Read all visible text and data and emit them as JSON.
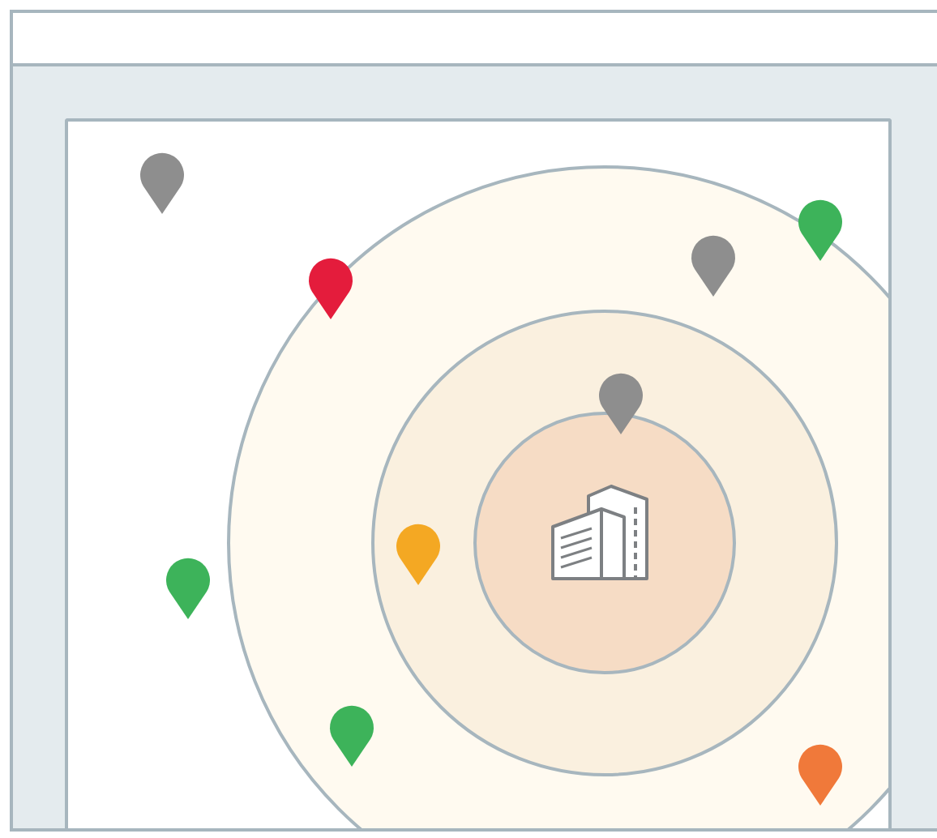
{
  "map": {
    "pins": [
      {
        "color": "#8e8e8e"
      },
      {
        "color": "#e41c3c"
      },
      {
        "color": "#8e8e8e"
      },
      {
        "color": "#3db35a"
      },
      {
        "color": "#8e8e8e"
      },
      {
        "color": "#f4a823"
      },
      {
        "color": "#3db35a"
      },
      {
        "color": "#3db35a"
      },
      {
        "color": "#f0793a"
      }
    ]
  }
}
